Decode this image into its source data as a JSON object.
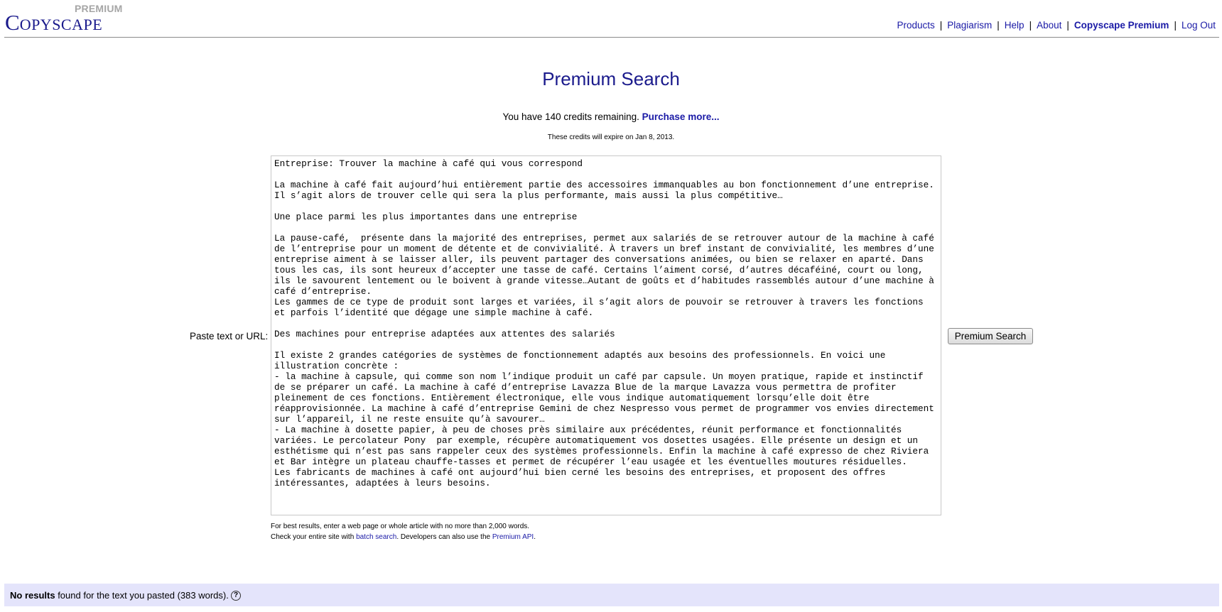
{
  "logo": {
    "first_letter": "C",
    "rest": "OPYSCAPE",
    "edition": "PREMIUM"
  },
  "topnav": {
    "items": [
      "Products",
      "Plagiarism",
      "Help",
      "About",
      "Copyscape Premium",
      "Log Out"
    ],
    "separator": "|"
  },
  "page": {
    "title": "Premium Search",
    "credits_prefix": "You have 140 credits remaining.",
    "purchase_link": "Purchase more...",
    "expiry": "These credits will expire on Jan 8, 2013."
  },
  "form": {
    "paste_label": "Paste text or URL:",
    "text_value": "Entreprise: Trouver la machine à café qui vous correspond\n\nLa machine à café fait aujourd’hui entièrement partie des accessoires immanquables au bon fonctionnement d’une entreprise. Il s’agit alors de trouver celle qui sera la plus performante, mais aussi la plus compétitive…\n\nUne place parmi les plus importantes dans une entreprise\n\nLa pause-café,  présente dans la majorité des entreprises, permet aux salariés de se retrouver autour de la machine à café de l’entreprise pour un moment de détente et de convivialité. À travers un bref instant de convivialité, les membres d’une entreprise aiment à se laisser aller, ils peuvent partager des conversations animées, ou bien se relaxer en aparté. Dans tous les cas, ils sont heureux d’accepter une tasse de café. Certains l’aiment corsé, d’autres décaféiné, court ou long, ils le savourent lentement ou le boivent à grande vitesse…Autant de goûts et d’habitudes rassemblés autour d’une machine à café d’entreprise.\nLes gammes de ce type de produit sont larges et variées, il s’agit alors de pouvoir se retrouver à travers les fonctions et parfois l’identité que dégage une simple machine à café.\n\nDes machines pour entreprise adaptées aux attentes des salariés\n\nIl existe 2 grandes catégories de systèmes de fonctionnement adaptés aux besoins des professionnels. En voici une illustration concrète :\n- la machine à capsule, qui comme son nom l’indique produit un café par capsule. Un moyen pratique, rapide et instinctif de se préparer un café. La machine à café d’entreprise Lavazza Blue de la marque Lavazza vous permettra de profiter pleinement de ces fonctions. Entièrement électronique, elle vous indique automatiquement lorsqu’elle doit être réapprovisionnée. La machine à café d’entreprise Gemini de chez Nespresso vous permet de programmer vos envies directement sur l’appareil, il ne reste ensuite qu’à savourer…\n- La machine à dosette papier, à peu de choses près similaire aux précédentes, réunit performance et fonctionnalités variées. Le percolateur Pony  par exemple, récupère automatiquement vos dosettes usagées. Elle présente un design et un esthétisme qui n’est pas sans rappeler ceux des systèmes professionnels. Enfin la machine à café expresso de chez Riviera et Bar intègre un plateau chauffe-tasses et permet de récupérer l’eau usagée et les éventuelles moutures résiduelles.\nLes fabricants de machines à café ont aujourd’hui bien cerné les besoins des entreprises, et proposent des offres intéressantes, adaptées à leurs besoins.",
    "search_button": "Premium Search",
    "hint_line1": "For best results, enter a web page or whole article with no more than 2,000 words.",
    "hint_line2_a": "Check your entire site with ",
    "batch_link": "batch search",
    "hint_line2_b": ". Developers can also use the ",
    "api_link": "Premium API",
    "hint_line2_c": "."
  },
  "results": {
    "bold": "No results",
    "rest": " found for the text you pasted (383 words).",
    "help_icon": "?"
  }
}
